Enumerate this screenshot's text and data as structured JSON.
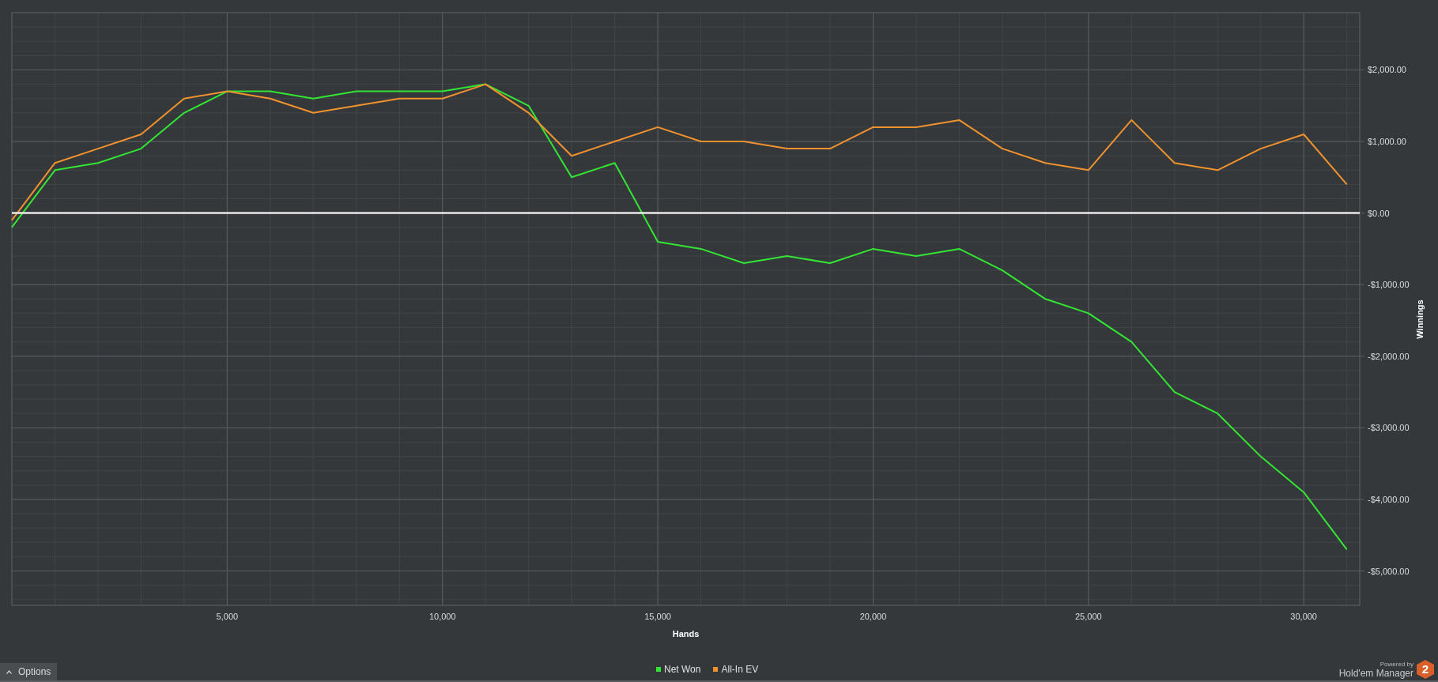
{
  "chart_data": {
    "type": "line",
    "grid": true,
    "xlabel": "Hands",
    "ylabel": "Winnings",
    "xlim": [
      0,
      31300
    ],
    "ylim": [
      -5480,
      2800
    ],
    "xticks": [
      {
        "value": 5000,
        "label": "5,000"
      },
      {
        "value": 10000,
        "label": "10,000"
      },
      {
        "value": 15000,
        "label": "15,000"
      },
      {
        "value": 20000,
        "label": "20,000"
      },
      {
        "value": 25000,
        "label": "25,000"
      },
      {
        "value": 30000,
        "label": "30,000"
      }
    ],
    "yticks": [
      {
        "value": 2000,
        "label": "$2,000.00"
      },
      {
        "value": 1000,
        "label": "$1,000.00"
      },
      {
        "value": 0,
        "label": "$0.00"
      },
      {
        "value": -1000,
        "label": "-$1,000.00"
      },
      {
        "value": -2000,
        "label": "-$2,000.00"
      },
      {
        "value": -3000,
        "label": "-$3,000.00"
      },
      {
        "value": -4000,
        "label": "-$4,000.00"
      },
      {
        "value": -5000,
        "label": "-$5,000.00"
      }
    ],
    "x": [
      0,
      1000,
      2000,
      3000,
      4000,
      5000,
      6000,
      7000,
      8000,
      9000,
      10000,
      11000,
      12000,
      13000,
      14000,
      15000,
      16000,
      17000,
      18000,
      19000,
      20000,
      21000,
      22000,
      23000,
      24000,
      25000,
      26000,
      27000,
      28000,
      29000,
      30000,
      31000
    ],
    "series": [
      {
        "name": "Net Won",
        "color": "#33e633",
        "values": [
          -200,
          600,
          700,
          900,
          1400,
          1700,
          1700,
          1600,
          1700,
          1700,
          1700,
          1800,
          1500,
          500,
          700,
          -400,
          -500,
          -700,
          -600,
          -700,
          -500,
          -600,
          -500,
          -800,
          -1200,
          -1400,
          -1800,
          -2500,
          -2800,
          -3400,
          -3900,
          -4700
        ]
      },
      {
        "name": "All-In EV",
        "color": "#f0922e",
        "values": [
          -100,
          700,
          900,
          1100,
          1600,
          1700,
          1600,
          1400,
          1500,
          1600,
          1600,
          1800,
          1400,
          800,
          1000,
          1200,
          1000,
          1000,
          900,
          900,
          1200,
          1200,
          1300,
          900,
          700,
          600,
          1300,
          700,
          600,
          900,
          1100,
          400
        ]
      }
    ]
  },
  "options_button": {
    "label": "Options"
  },
  "branding": {
    "powered_by": "Powered by",
    "product": "Hold'em Manager",
    "badge": "2"
  }
}
